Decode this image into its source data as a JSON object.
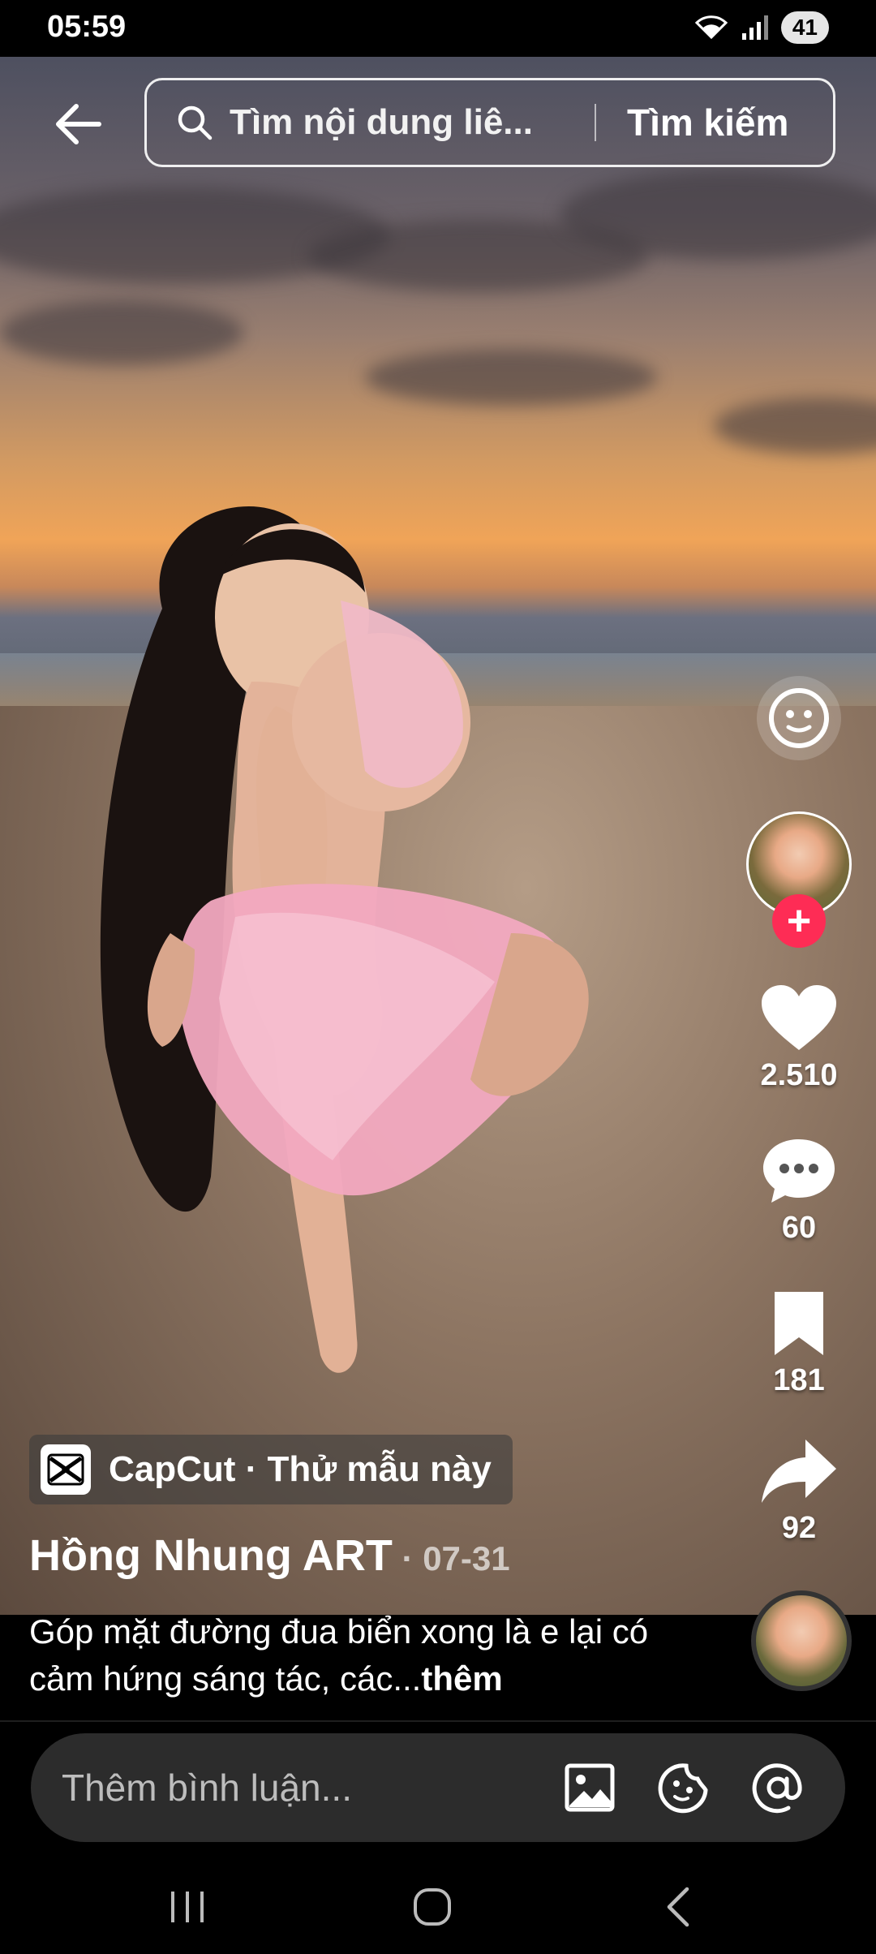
{
  "status_bar": {
    "time": "05:59",
    "battery": "41"
  },
  "search": {
    "placeholder": "Tìm nội dung liê...",
    "submit_label": "Tìm kiếm"
  },
  "rail": {
    "likes": "2.510",
    "comments": "60",
    "saves": "181",
    "shares": "92"
  },
  "template_chip": {
    "label": "CapCut · Thử mẫu này"
  },
  "post": {
    "author": "Hồng Nhung ART",
    "date": " · 07-31",
    "caption": "Góp mặt đường đua biển xong là e lại có cảm hứng sáng tác, các...",
    "more_label": "thêm"
  },
  "comment_bar": {
    "placeholder": "Thêm bình luận..."
  },
  "colors": {
    "follow_accent": "#fe2c55",
    "background": "#000000"
  },
  "icons": [
    "back-arrow-icon",
    "search-icon",
    "filter-face-icon",
    "heart-icon",
    "comment-bubble-icon",
    "bookmark-icon",
    "share-arrow-icon",
    "image-icon",
    "emoji-icon",
    "at-sign-icon",
    "recents-icon",
    "home-icon",
    "back-nav-icon"
  ]
}
